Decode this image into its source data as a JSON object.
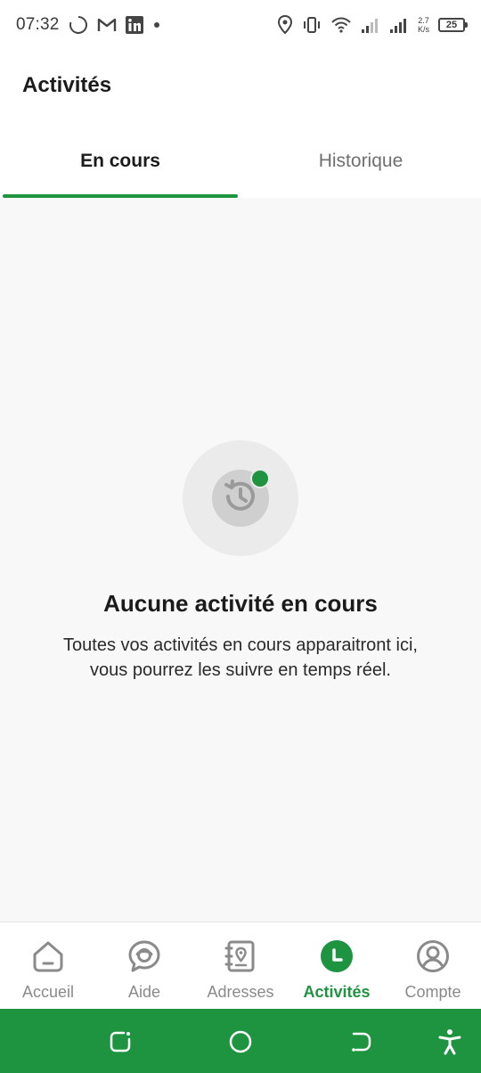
{
  "status_bar": {
    "time": "07:32",
    "speed_value": "2.7",
    "speed_unit": "K/s",
    "battery": "25"
  },
  "header": {
    "title": "Activités"
  },
  "tabs": [
    {
      "label": "En cours",
      "active": true
    },
    {
      "label": "Historique",
      "active": false
    }
  ],
  "empty_state": {
    "icon": "history-icon",
    "title": "Aucune activité en cours",
    "description_line1": "Toutes vos activités en cours apparaitront ici,",
    "description_line2": "vous pourrez les suivre en temps réel."
  },
  "bottom_nav": {
    "items": [
      {
        "label": "Accueil",
        "icon": "home-icon"
      },
      {
        "label": "Aide",
        "icon": "chat-help-icon"
      },
      {
        "label": "Adresses",
        "icon": "address-book-icon"
      },
      {
        "label": "Activités",
        "icon": "activity-clock-icon",
        "active": true
      },
      {
        "label": "Compte",
        "icon": "account-icon"
      }
    ]
  },
  "colors": {
    "accent": "#1f9440",
    "background": "#f8f8f8",
    "text_primary": "#1b1b1b",
    "text_muted": "#8a8a8a"
  }
}
